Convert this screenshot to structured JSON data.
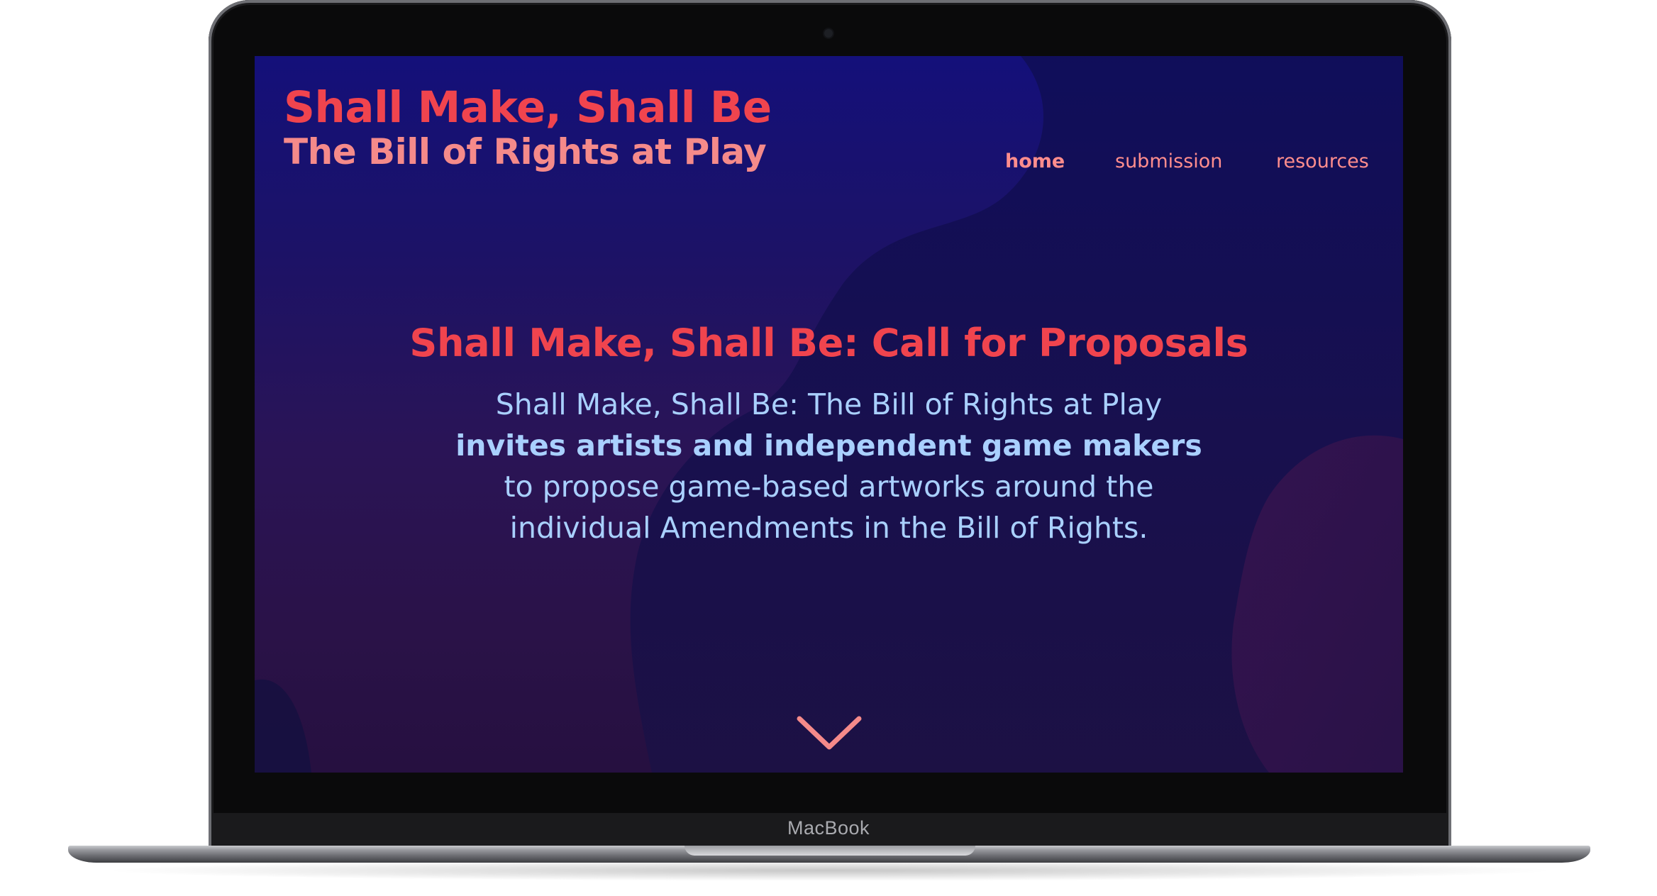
{
  "device": {
    "brand_label": "MacBook"
  },
  "site": {
    "title": "Shall Make, Shall Be",
    "subtitle": "The Bill of Rights at Play"
  },
  "nav": {
    "items": [
      {
        "label": "home",
        "active": true
      },
      {
        "label": "submission",
        "active": false
      },
      {
        "label": "resources",
        "active": false
      }
    ]
  },
  "hero": {
    "title": "Shall Make, Shall Be: Call for Proposals",
    "line1": "Shall Make, Shall Be: The Bill of Rights at Play",
    "line2": "invites artists and independent game makers",
    "line3": "to propose game-based artworks around the",
    "line4": "individual Amendments in the Bill of Rights."
  },
  "icons": {
    "scroll_down": "chevron-down-icon"
  },
  "colors": {
    "accent": "#f0444e",
    "subtitle": "#f58a8a",
    "nav": "#ff8d8d",
    "body": "#a9d0ff",
    "bg_top": "#14107a",
    "bg_bottom": "#261040"
  }
}
